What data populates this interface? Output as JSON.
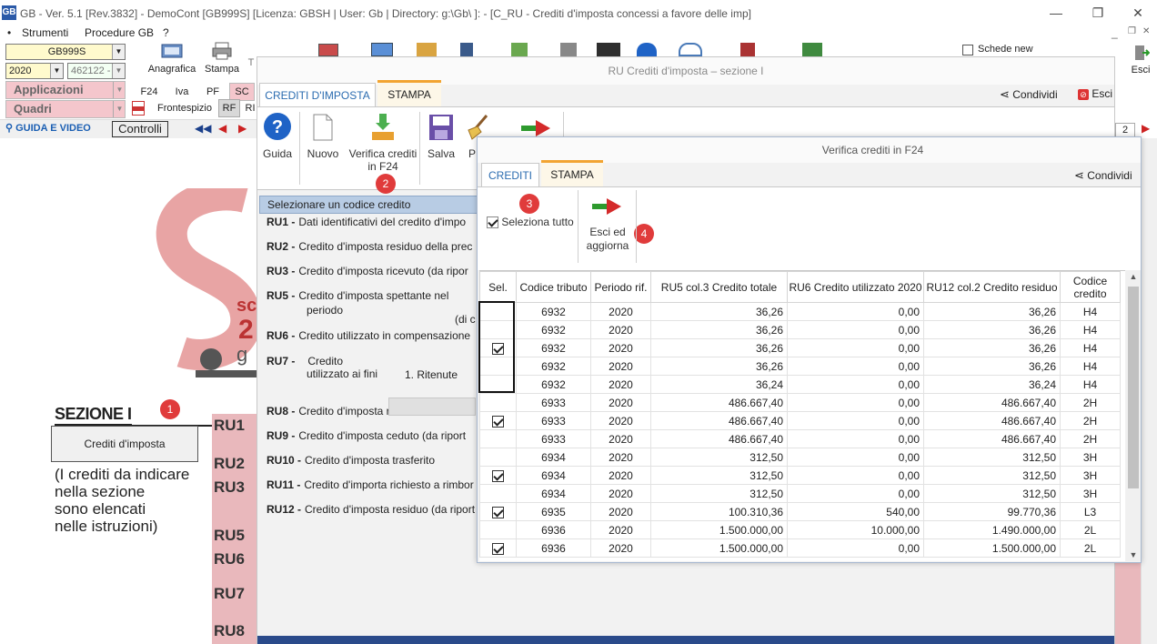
{
  "window": {
    "title": "GB - Ver. 5.1 [Rev.3832] -   DemoCont [GB999S]     [Licenza: GBSH | User: Gb | Directory: g:\\Gb\\ ]: - [C_RU - Crediti d'imposta concessi a favore delle imp]",
    "minimize": "—",
    "maximize": "❐",
    "close": "✕"
  },
  "menubar": {
    "bullet": "•",
    "items": [
      "Strumenti",
      "Procedure GB",
      "?"
    ]
  },
  "left": {
    "company_combo": "GB999S",
    "year_combo": "2020",
    "code_combo": "462122 -",
    "anagrafica_label": "Anagrafica",
    "stampa_label": "Stampa",
    "t_label": "T",
    "applicazioni_label": "Applicazioni",
    "quadri_label": "Quadri",
    "tabs_row1": [
      "F24",
      "Iva",
      "PF",
      "SC"
    ],
    "tabs_row2": [
      "Frontespizio",
      "RF",
      "RI"
    ],
    "guida_video_label": "GUIDA E VIDEO",
    "controlli_label": "Controlli",
    "schede_new_label": "Schede new",
    "esci_label": "Esci",
    "page_field": "2"
  },
  "document": {
    "sezione_title": "SEZIONE I",
    "crediti_button": "Crediti d'imposta",
    "note_lines": [
      "(I crediti da indicare",
      "nella sezione",
      "sono elencati",
      "nelle istruzioni)"
    ],
    "ru_labels": [
      "RU1",
      "RU2",
      "RU3",
      "RU5",
      "RU6",
      "RU7",
      "RU8"
    ],
    "badge1": "1"
  },
  "dialog1": {
    "title": "RU Crediti d'imposta – sezione I",
    "tabs": [
      "CREDITI D'IMPOSTA",
      "STAMPA"
    ],
    "condividi": "Condividi",
    "esci": "Esci",
    "toolbar": {
      "guida": "Guida",
      "nuovo": "Nuovo",
      "verifica": "Verifica crediti in F24",
      "salva": "Salva",
      "p": "P"
    },
    "badge2": "2",
    "codelist_header": "Selezionare un codice credito",
    "codes": [
      {
        "code": "RU1 -",
        "desc": "Dati identificativi del credito d'impo"
      },
      {
        "code": "RU2 -",
        "desc": "Credito d'imposta residuo della prec"
      },
      {
        "code": "RU3 -",
        "desc": "Credito d'imposta ricevuto (da ripor"
      },
      {
        "code": "RU5 -",
        "desc": "Credito d'imposta spettante nel"
      },
      {
        "code": "RU6 -",
        "desc": "Credito utilizzato in compensazione"
      },
      {
        "code": "RU7 -",
        "desc": "Credito"
      },
      {
        "code": "RU8 -",
        "desc": "Credito d'imposta riversato"
      },
      {
        "code": "RU9 -",
        "desc": "Credito d'imposta ceduto (da riport"
      },
      {
        "code": "RU10 -",
        "desc": "Credito d'imposta trasferito"
      },
      {
        "code": "RU11 -",
        "desc": "Credito d'importa richiesto a rimbor"
      },
      {
        "code": "RU12 -",
        "desc": "Credito d'imposta residuo (da riport"
      }
    ],
    "ru5_line2": "periodo",
    "ru5_line3": "(di c",
    "ru7_line2": "utilizzato ai fini",
    "ru7_ritenute": "1. Ritenute"
  },
  "dialog2": {
    "title": "Verifica crediti in F24",
    "tabs": [
      "CREDITI",
      "STAMPA"
    ],
    "condividi": "Condividi",
    "seleziona_tutto": "Seleziona tutto",
    "esci_aggiorna": "Esci ed aggiorna",
    "badge3": "3",
    "badge4": "4",
    "columns": [
      "Sel.",
      "Codice tributo",
      "Periodo rif.",
      "RU5 col.3 Credito totale",
      "RU6 Credito utilizzato 2020",
      "RU12 col.2 Credito residuo",
      "Codice credito"
    ],
    "rows": [
      {
        "sel": false,
        "tributo": "6932",
        "periodo": "2020",
        "totale": "36,26",
        "utilizzato": "0,00",
        "residuo": "36,26",
        "codice": "H4"
      },
      {
        "sel": false,
        "tributo": "6932",
        "periodo": "2020",
        "totale": "36,26",
        "utilizzato": "0,00",
        "residuo": "36,26",
        "codice": "H4"
      },
      {
        "sel": true,
        "tributo": "6932",
        "periodo": "2020",
        "totale": "36,26",
        "utilizzato": "0,00",
        "residuo": "36,26",
        "codice": "H4"
      },
      {
        "sel": false,
        "tributo": "6932",
        "periodo": "2020",
        "totale": "36,26",
        "utilizzato": "0,00",
        "residuo": "36,26",
        "codice": "H4"
      },
      {
        "sel": false,
        "tributo": "6932",
        "periodo": "2020",
        "totale": "36,24",
        "utilizzato": "0,00",
        "residuo": "36,24",
        "codice": "H4"
      },
      {
        "sel": false,
        "tributo": "6933",
        "periodo": "2020",
        "totale": "486.667,40",
        "utilizzato": "0,00",
        "residuo": "486.667,40",
        "codice": "2H"
      },
      {
        "sel": true,
        "tributo": "6933",
        "periodo": "2020",
        "totale": "486.667,40",
        "utilizzato": "0,00",
        "residuo": "486.667,40",
        "codice": "2H"
      },
      {
        "sel": false,
        "tributo": "6933",
        "periodo": "2020",
        "totale": "486.667,40",
        "utilizzato": "0,00",
        "residuo": "486.667,40",
        "codice": "2H"
      },
      {
        "sel": false,
        "tributo": "6934",
        "periodo": "2020",
        "totale": "312,50",
        "utilizzato": "0,00",
        "residuo": "312,50",
        "codice": "3H"
      },
      {
        "sel": true,
        "tributo": "6934",
        "periodo": "2020",
        "totale": "312,50",
        "utilizzato": "0,00",
        "residuo": "312,50",
        "codice": "3H"
      },
      {
        "sel": false,
        "tributo": "6934",
        "periodo": "2020",
        "totale": "312,50",
        "utilizzato": "0,00",
        "residuo": "312,50",
        "codice": "3H"
      },
      {
        "sel": true,
        "tributo": "6935",
        "periodo": "2020",
        "totale": "100.310,36",
        "utilizzato": "540,00",
        "residuo": "99.770,36",
        "codice": "L3"
      },
      {
        "sel": false,
        "tributo": "6936",
        "periodo": "2020",
        "totale": "1.500.000,00",
        "utilizzato": "10.000,00",
        "residuo": "1.490.000,00",
        "codice": "2L"
      },
      {
        "sel": true,
        "tributo": "6936",
        "periodo": "2020",
        "totale": "1.500.000,00",
        "utilizzato": "0,00",
        "residuo": "1.500.000,00",
        "codice": "2L"
      }
    ]
  },
  "colors": {
    "badge": "#e03b3b",
    "tab_accent": "#f2a431",
    "active_tab_text": "#2b6cb0",
    "pink_bar": "#f4c6cc"
  }
}
